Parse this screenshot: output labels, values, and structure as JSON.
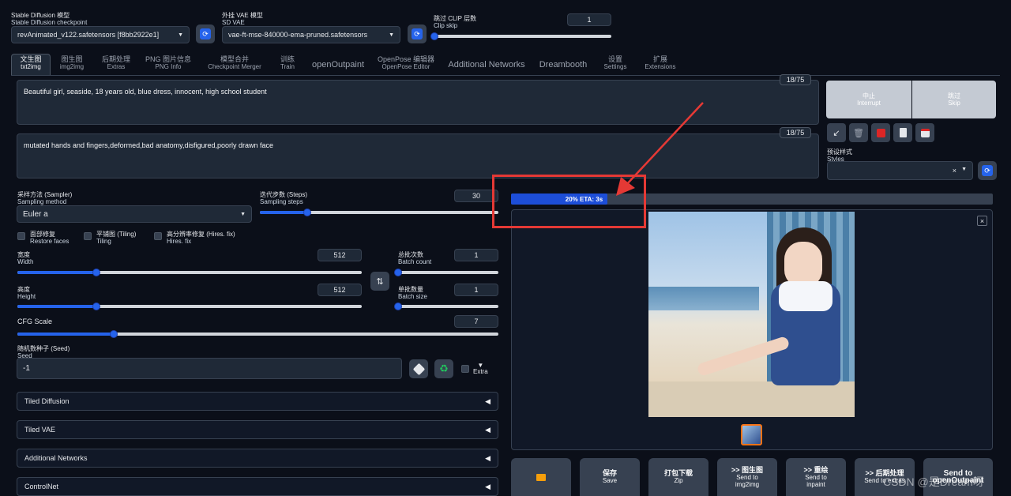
{
  "top": {
    "checkpoint": {
      "label_zh": "Stable Diffusion 模型",
      "label_en": "Stable Diffusion checkpoint",
      "value": "revAnimated_v122.safetensors [f8bb2922e1]"
    },
    "vae": {
      "label_zh": "外挂 VAE 模型",
      "label_en": "SD VAE",
      "value": "vae-ft-mse-840000-ema-pruned.safetensors"
    },
    "clip_skip": {
      "label_zh": "跳过 CLIP 层数",
      "label_en": "Clip skip",
      "value": "1"
    }
  },
  "tabs": [
    {
      "zh": "文生图",
      "en": "txt2img"
    },
    {
      "zh": "图生图",
      "en": "img2img"
    },
    {
      "zh": "后期处理",
      "en": "Extras"
    },
    {
      "zh": "PNG 图片信息",
      "en": "PNG Info"
    },
    {
      "zh": "模型合并",
      "en": "Checkpoint Merger"
    },
    {
      "zh": "训练",
      "en": "Train"
    },
    {
      "zh": "openOutpaint",
      "en": ""
    },
    {
      "zh": "OpenPose 编辑器",
      "en": "OpenPose Editor"
    },
    {
      "zh": "Additional Networks",
      "en": ""
    },
    {
      "zh": "Dreambooth",
      "en": ""
    },
    {
      "zh": "设置",
      "en": "Settings"
    },
    {
      "zh": "扩展",
      "en": "Extensions"
    }
  ],
  "prompt": {
    "text": "Beautiful girl, seaside, 18 years old, blue dress, innocent, high school student",
    "tokens": "18/75"
  },
  "negative": {
    "text": "mutated hands and fingers,deformed,bad anatomy,disfigured,poorly drawn face",
    "tokens": "18/75"
  },
  "actions": {
    "interrupt_zh": "中止",
    "interrupt_en": "Interrupt",
    "skip_zh": "跳过",
    "skip_en": "Skip"
  },
  "styles": {
    "label_zh": "预设样式",
    "label_en": "Styles",
    "clear": "×"
  },
  "sampler": {
    "label_zh": "采样方法 (Sampler)",
    "label_en": "Sampling method",
    "value": "Euler a"
  },
  "steps": {
    "label_zh": "迭代步数 (Steps)",
    "label_en": "Sampling steps",
    "value": "30",
    "fraction": 0.2
  },
  "checks": [
    {
      "zh": "面部修复",
      "en": "Restore faces"
    },
    {
      "zh": "平铺图 (Tiling)",
      "en": "Tiling"
    },
    {
      "zh": "高分辨率修复 (Hires. fix)",
      "en": "Hires. fix"
    }
  ],
  "width": {
    "label_zh": "宽度",
    "label_en": "Width",
    "value": "512",
    "fraction": 0.23
  },
  "height": {
    "label_zh": "高度",
    "label_en": "Height",
    "value": "512",
    "fraction": 0.23
  },
  "batch_count": {
    "label_zh": "总批次数",
    "label_en": "Batch count",
    "value": "1",
    "fraction": 0.0
  },
  "batch_size": {
    "label_zh": "单批数量",
    "label_en": "Batch size",
    "value": "1",
    "fraction": 0.0
  },
  "cfg": {
    "label": "CFG Scale",
    "value": "7",
    "fraction": 0.2
  },
  "seed": {
    "label_zh": "随机数种子 (Seed)",
    "label_en": "Seed",
    "value": "-1",
    "extra": "Extra",
    "extra_arrow": "▼"
  },
  "accordions": [
    "Tiled Diffusion",
    "Tiled VAE",
    "Additional Networks",
    "ControlNet"
  ],
  "progress": {
    "text": "20% ETA: 3s",
    "fraction": 0.2
  },
  "close_glyph": "×",
  "bottom_buttons": [
    {
      "zh": "",
      "en": ""
    },
    {
      "zh": "保存",
      "en": "Save"
    },
    {
      "zh": "打包下载",
      "en": "Zip"
    },
    {
      "zh": ">> 图生图",
      "en": "Send to img2img"
    },
    {
      "zh": ">> 重绘",
      "en": "Send to inpaint"
    },
    {
      "zh": ">> 后期处理",
      "en": "Send to extras"
    },
    {
      "zh": "Send to",
      "en": "openOutpaint"
    }
  ],
  "watermark": "CSDN @是Dream呀",
  "colors": {
    "accent": "#2563eb",
    "annotation": "#e53935",
    "background": "#0b0f19"
  }
}
